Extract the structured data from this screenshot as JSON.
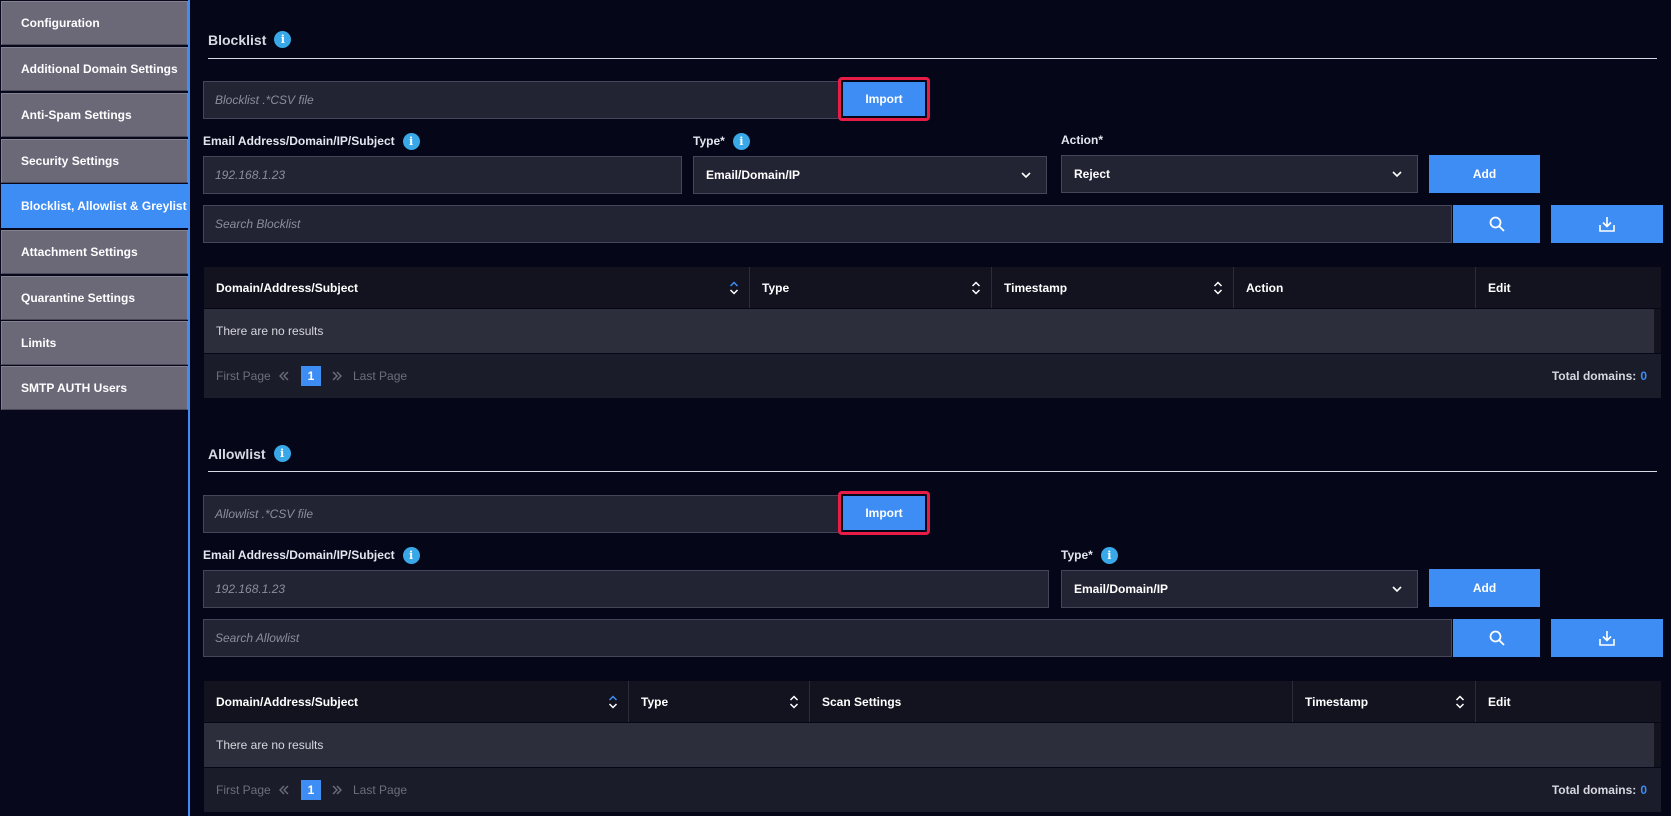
{
  "sidebar": {
    "items": [
      {
        "label": "Configuration"
      },
      {
        "label": "Additional Domain Settings"
      },
      {
        "label": "Anti-Spam Settings"
      },
      {
        "label": "Security Settings"
      },
      {
        "label": "Blocklist, Allowlist & Greylist",
        "active": true
      },
      {
        "label": "Attachment Settings"
      },
      {
        "label": "Quarantine Settings"
      },
      {
        "label": "Limits"
      },
      {
        "label": "SMTP AUTH Users"
      }
    ]
  },
  "blocklist": {
    "title": "Blocklist",
    "file_placeholder": "Blocklist .*CSV file",
    "import_label": "Import",
    "address_label": "Email Address/Domain/IP/Subject",
    "address_placeholder": "192.168.1.23",
    "type_label": "Type*",
    "type_value": "Email/Domain/IP",
    "action_label": "Action*",
    "action_value": "Reject",
    "add_label": "Add",
    "search_placeholder": "Search Blocklist",
    "columns": [
      "Domain/Address/Subject",
      "Type",
      "Timestamp",
      "Action",
      "Edit"
    ],
    "empty_text": "There are no results",
    "pager": {
      "first": "First Page",
      "page": "1",
      "last": "Last Page",
      "total_label": "Total domains:",
      "total": "0"
    }
  },
  "allowlist": {
    "title": "Allowlist",
    "file_placeholder": "Allowlist .*CSV file",
    "import_label": "Import",
    "address_label": "Email Address/Domain/IP/Subject",
    "address_placeholder": "192.168.1.23",
    "type_label": "Type*",
    "type_value": "Email/Domain/IP",
    "add_label": "Add",
    "search_placeholder": "Search Allowlist",
    "columns": [
      "Domain/Address/Subject",
      "Type",
      "Scan Settings",
      "Timestamp",
      "Edit"
    ],
    "empty_text": "There are no results",
    "pager": {
      "first": "First Page",
      "page": "1",
      "last": "Last Page",
      "total_label": "Total domains:",
      "total": "0"
    }
  },
  "colors": {
    "accent": "#3d8df5",
    "highlight": "#e81c47",
    "background": "#050617"
  }
}
